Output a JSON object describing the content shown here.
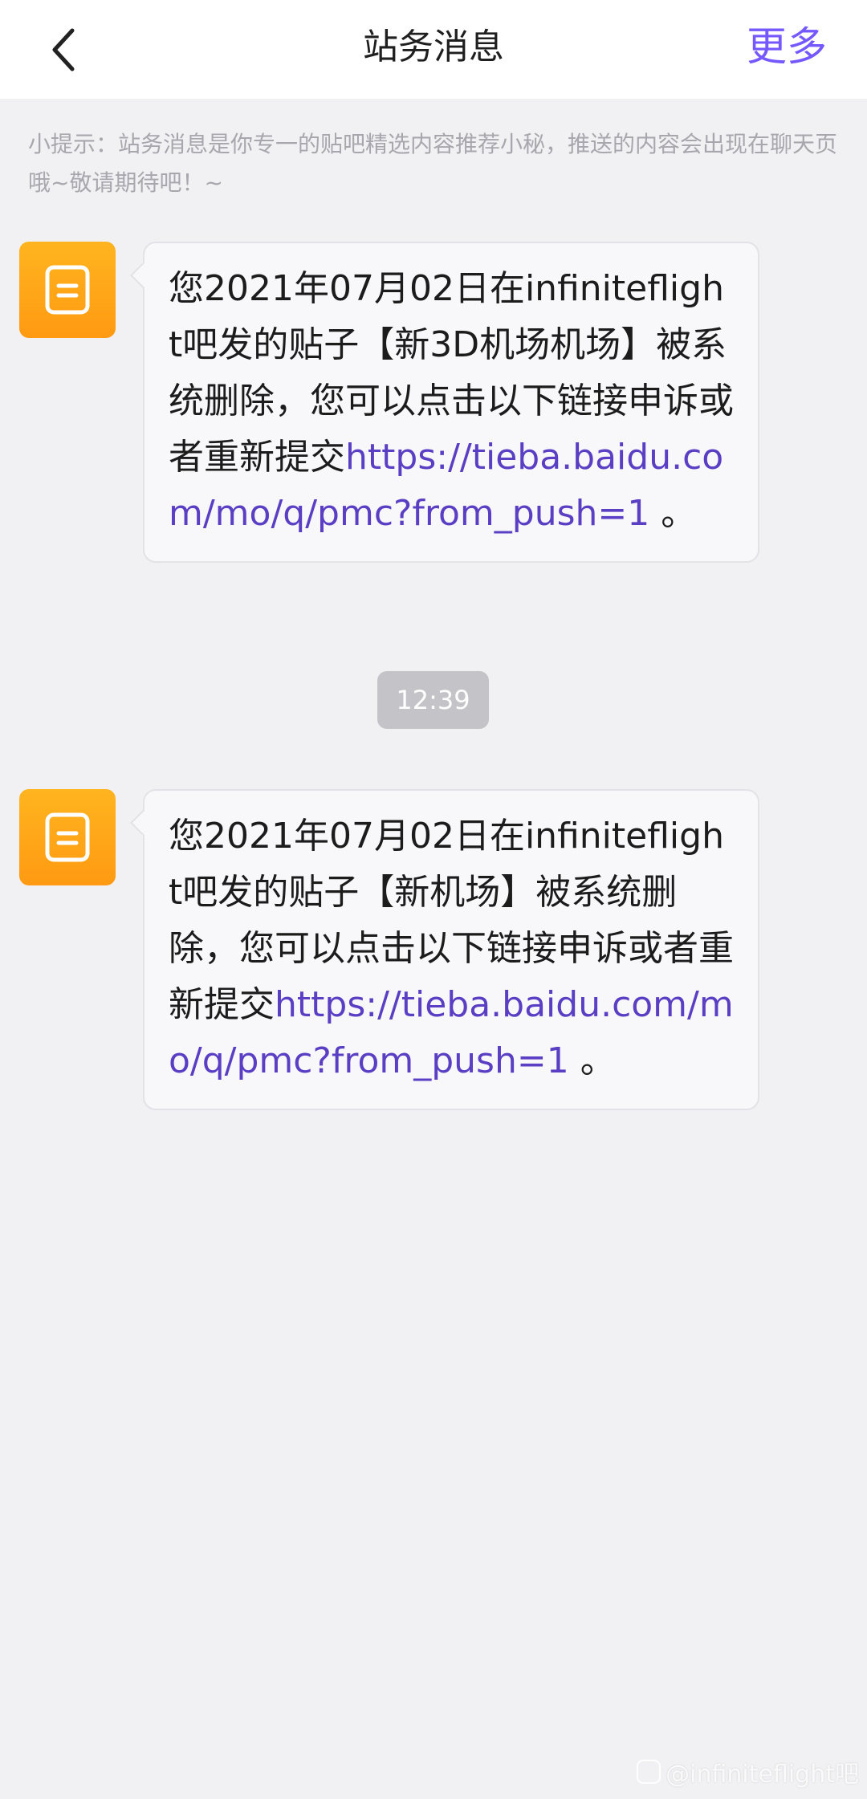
{
  "header": {
    "title": "站务消息",
    "more_label": "更多"
  },
  "tip": "小提示：站务消息是你专一的贴吧精选内容推荐小秘，推送的内容会出现在聊天页哦~敬请期待吧！~",
  "messages": [
    {
      "text": "您2021年07月02日在infiniteflight吧发的贴子【新3D机场机场】被系统删除，您可以点击以下链接申诉或者重新提交",
      "link": "https://tieba.baidu.com/mo/q/pmc?from_push=1",
      "suffix": " 。"
    },
    {
      "text": "您2021年07月02日在infiniteflight吧发的贴子【新机场】被系统删除，您可以点击以下链接申诉或者重新提交",
      "link": "https://tieba.baidu.com/mo/q/pmc?from_push=1",
      "suffix": " 。"
    }
  ],
  "timestamp": "12:39",
  "watermark": "@infiniteflight吧",
  "colors": {
    "accent": "#7559ff",
    "link": "#5a3fc4",
    "avatar": "#ffa516",
    "background": "#f1f1f4"
  },
  "icons": {
    "back": "chevron-left-icon",
    "avatar": "notice-document-icon"
  }
}
